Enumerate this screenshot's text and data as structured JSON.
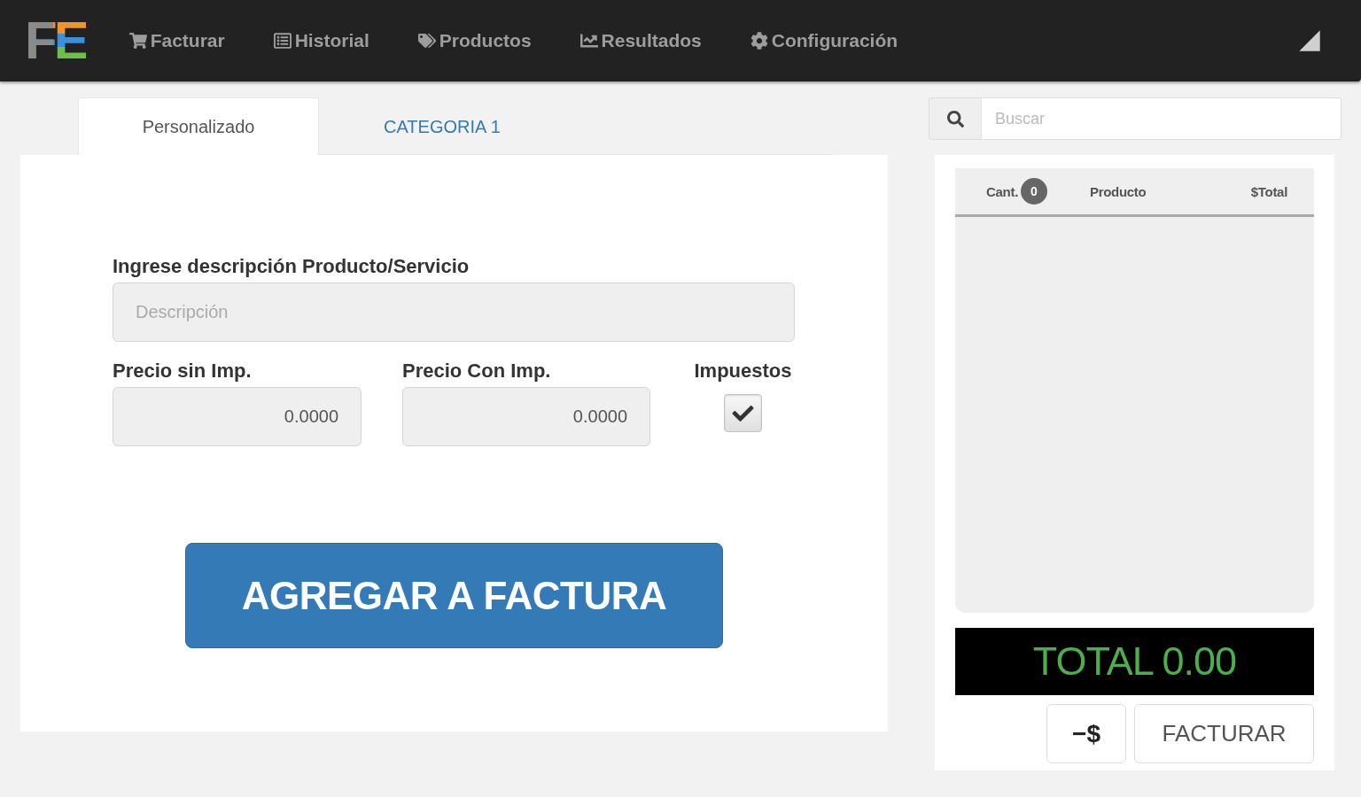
{
  "navbar": {
    "brand": "FE",
    "items": [
      {
        "label": "Facturar"
      },
      {
        "label": "Historial"
      },
      {
        "label": "Productos"
      },
      {
        "label": "Resultados"
      },
      {
        "label": "Configuración"
      }
    ]
  },
  "tabs": [
    {
      "label": "Personalizado",
      "selected": true
    },
    {
      "label": "CATEGORIA 1",
      "selected": false
    }
  ],
  "form": {
    "description": {
      "label": "Ingrese descripción Producto/Servicio",
      "placeholder": "Descripción"
    },
    "price_without_tax": {
      "label": "Precio sin Imp.",
      "value": "0.0000"
    },
    "price_with_tax": {
      "label": "Precio Con Imp.",
      "value": "0.0000"
    },
    "taxes": {
      "label": "Impuestos",
      "checked": true
    },
    "add_button": "AGREGAR A FACTURA"
  },
  "search": {
    "placeholder": "Buscar"
  },
  "cart": {
    "columns": [
      {
        "label": "Cant.",
        "badge": "0"
      },
      {
        "label": "Producto"
      },
      {
        "label": "$Total"
      }
    ],
    "total": "TOTAL 0.00",
    "buttons": [
      "−$",
      "FACTURAR"
    ]
  }
}
